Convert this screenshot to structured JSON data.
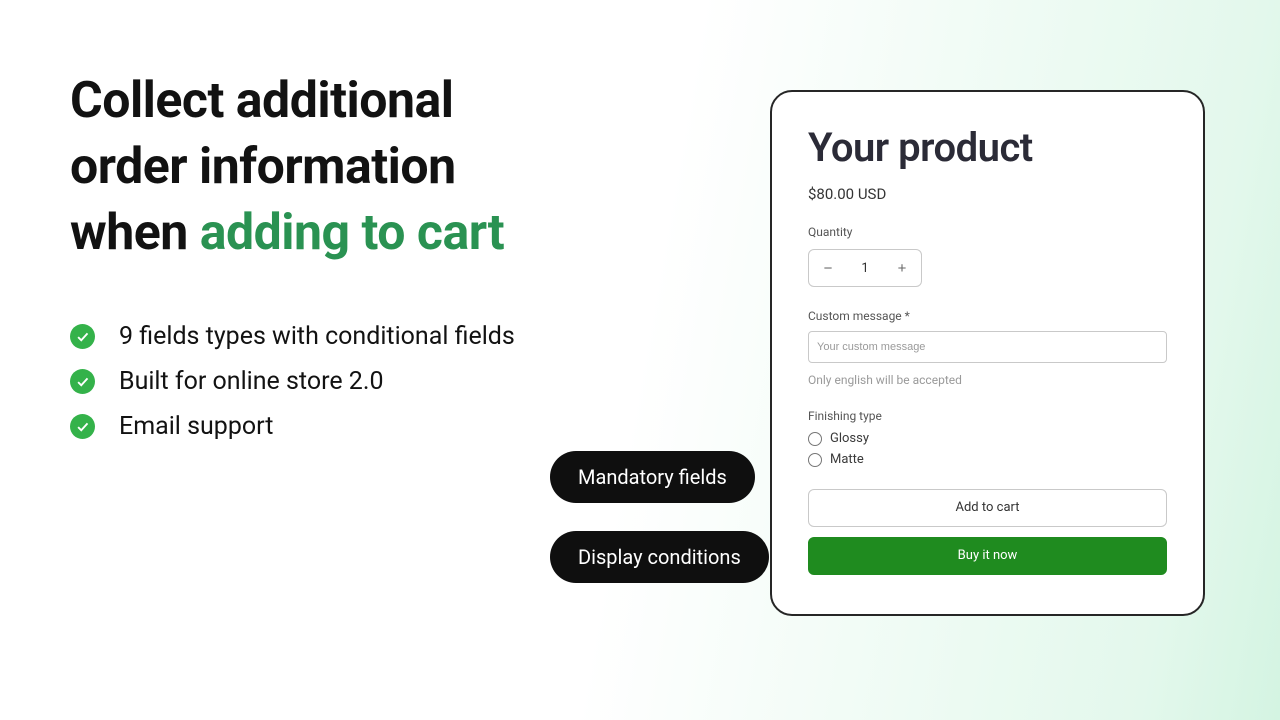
{
  "heading": {
    "line1": "Collect additional",
    "line2": "order information",
    "line3_pre": "when ",
    "line3_accent": "adding to cart"
  },
  "bullets": [
    "9 fields types with conditional fields",
    "Built for online store 2.0",
    "Email support"
  ],
  "pills": {
    "mandatory": "Mandatory fields",
    "conditions": "Display conditions"
  },
  "product": {
    "title": "Your product",
    "price": "$80.00 USD",
    "quantity_label": "Quantity",
    "quantity_value": "1",
    "custom_message_label": "Custom message *",
    "custom_message_placeholder": "Your custom message",
    "custom_message_hint": "Only english will be accepted",
    "finishing_label": "Finishing type",
    "finishing_options": [
      "Glossy",
      "Matte"
    ],
    "add_to_cart": "Add to cart",
    "buy_now": "Buy it now"
  }
}
